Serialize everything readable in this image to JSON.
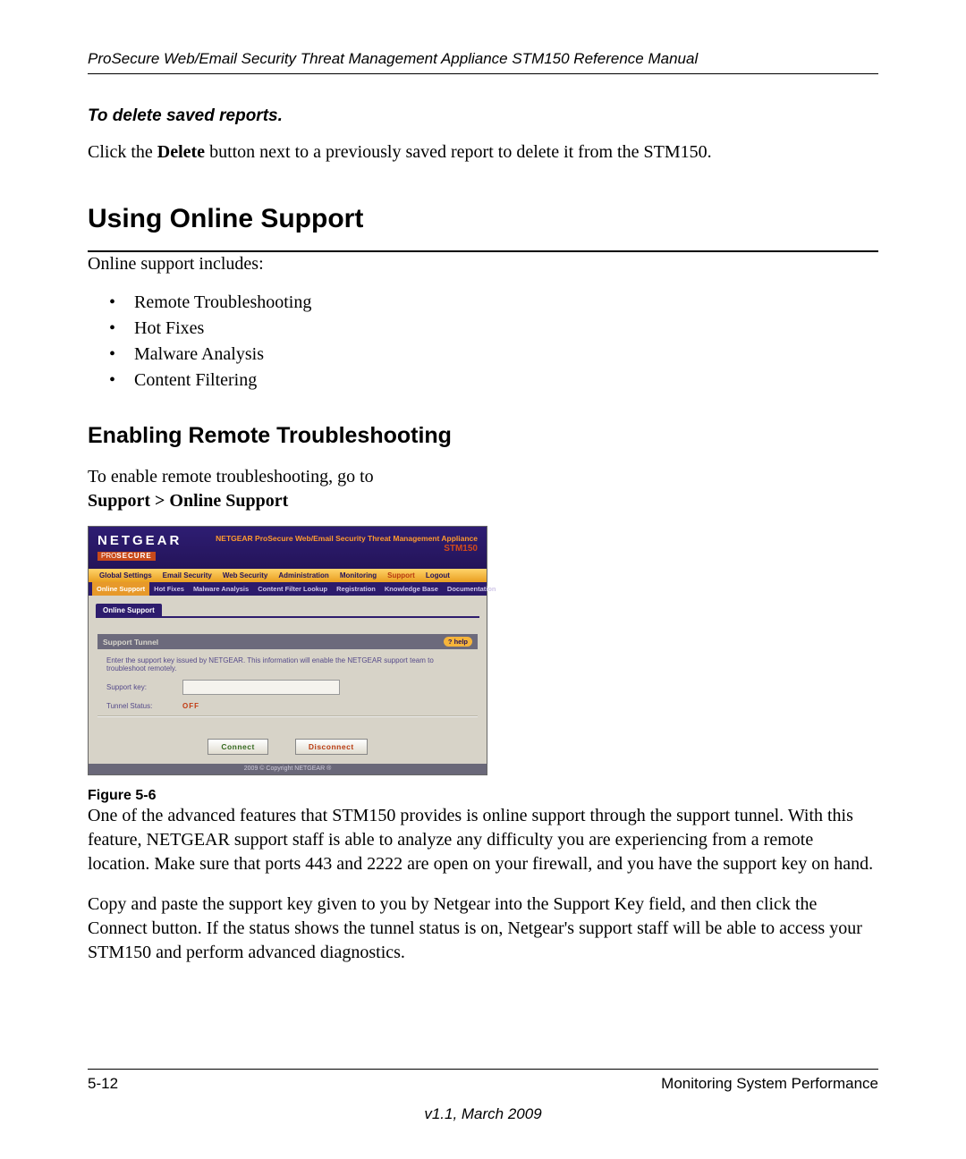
{
  "runningHead": "ProSecure Web/Email Security Threat Management Appliance STM150 Reference Manual",
  "deleteReports": {
    "heading": "To delete saved reports.",
    "body_pre": "Click the ",
    "body_bold": "Delete",
    "body_post": " button next to a previously saved report to delete it from the STM150."
  },
  "sectionTitle": "Using Online Support",
  "introLine": "Online support includes:",
  "bullets": [
    "Remote Troubleshooting",
    "Hot Fixes",
    "Malware Analysis",
    "Content Filtering"
  ],
  "subsectionTitle": "Enabling Remote Troubleshooting",
  "enableLine": "To enable remote troubleshooting, go to",
  "navPath": "Support > Online Support",
  "shot": {
    "brand": "NETGEAR",
    "prosecurePro": "PRO",
    "prosecureSecure": "SECURE",
    "titleLine": "NETGEAR ProSecure Web/Email Security Threat Management Appliance",
    "model": "STM150",
    "mainnav": [
      "Global Settings",
      "Email Security",
      "Web Security",
      "Administration",
      "Monitoring",
      "Support",
      "Logout"
    ],
    "mainnavActive": "Support",
    "subnav": [
      "Online Support",
      "Hot Fixes",
      "Malware Analysis",
      "Content Filter Lookup",
      "Registration",
      "Knowledge Base",
      "Documentation"
    ],
    "subnavActive": "Online Support",
    "breadcrumb": "Online Support",
    "panelTitle": "Support Tunnel",
    "help": "? help",
    "panelText": "Enter the support key issued by NETGEAR. This information will enable the NETGEAR support team to troubleshoot remotely.",
    "supportKeyLabel": "Support key:",
    "supportKeyValue": "",
    "tunnelStatusLabel": "Tunnel Status:",
    "tunnelStatusValue": "OFF",
    "connect": "Connect",
    "disconnect": "Disconnect",
    "copyright": "2009 © Copyright NETGEAR ®"
  },
  "figureCaption": "Figure 5-6",
  "para1": "One of the advanced features that STM150 provides is online support through the support tunnel. With this feature, NETGEAR support staff is able to analyze any difficulty you are experiencing from a remote location. Make sure that ports 443 and 2222 are open on your firewall, and you have the support key on hand.",
  "para2": "Copy and paste the support key given to you by Netgear into the Support Key field, and then click the Connect button. If the status shows the tunnel status is on, Netgear's support staff will be able to access your STM150 and perform advanced diagnostics.",
  "footer": {
    "left": "5-12",
    "right": "Monitoring System Performance",
    "version": "v1.1, March 2009"
  }
}
